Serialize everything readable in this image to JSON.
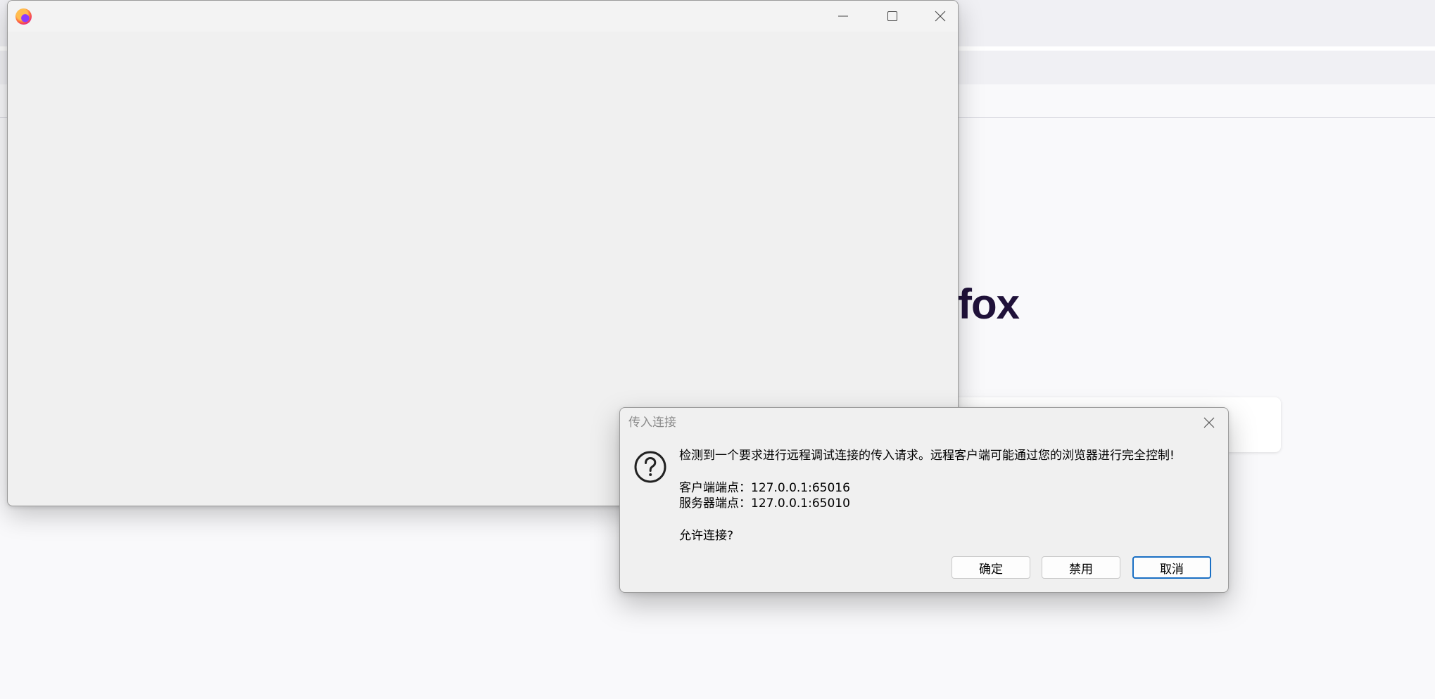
{
  "background_browser": {
    "brand_text": "fox"
  },
  "firefox_window": {
    "controls": [
      "minimize-icon",
      "maximize-icon",
      "close-icon"
    ]
  },
  "dialog": {
    "title": "传入连接",
    "message": "检测到一个要求进行远程调试连接的传入请求。远程客户端可能通过您的浏览器进行完全控制!",
    "client_endpoint": "客户端端点：127.0.0.1:65016",
    "server_endpoint": "服务器端点：127.0.0.1:65010",
    "question": "允许连接?",
    "buttons": {
      "ok": "确定",
      "disable": "禁用",
      "cancel": "取消"
    },
    "icon": "question-icon",
    "accent_color": "#1a6fc4"
  }
}
